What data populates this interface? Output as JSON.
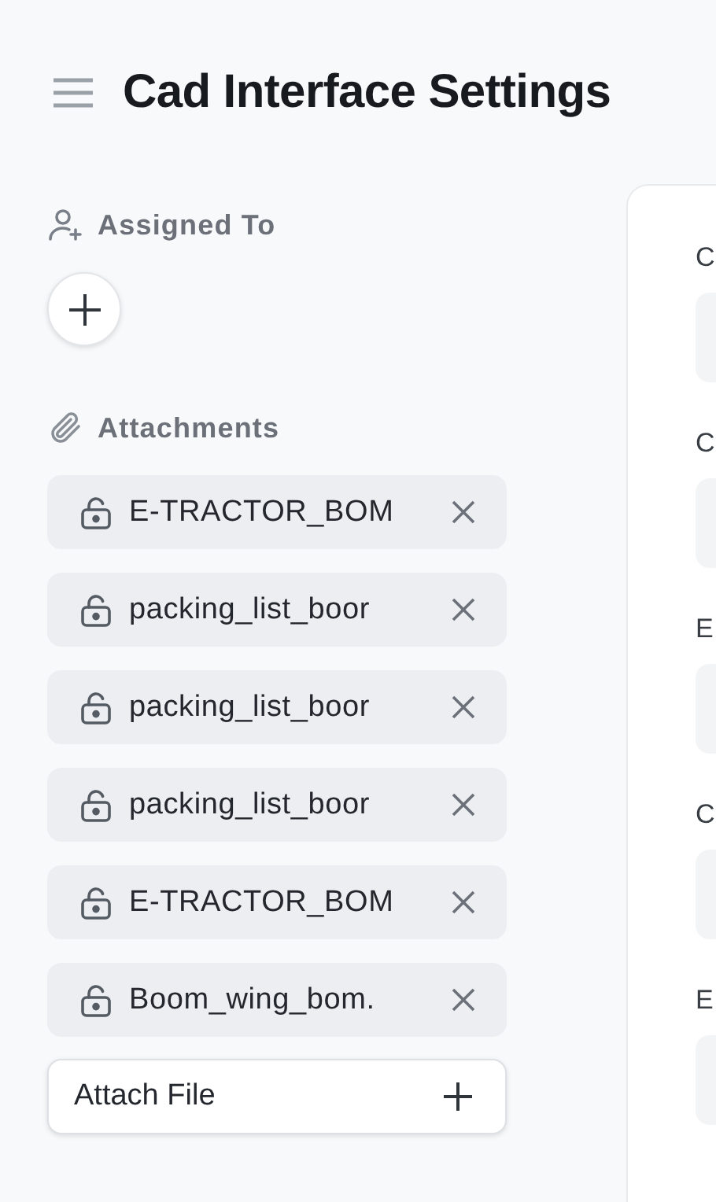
{
  "header": {
    "title": "Cad Interface Settings"
  },
  "sidebar": {
    "assigned_to": {
      "label": "Assigned To"
    },
    "attachments": {
      "label": "Attachments",
      "files": [
        {
          "name": "E-TRACTOR_BOM"
        },
        {
          "name": "packing_list_boor"
        },
        {
          "name": "packing_list_boor"
        },
        {
          "name": "packing_list_boor"
        },
        {
          "name": "E-TRACTOR_BOM"
        },
        {
          "name": "Boom_wing_bom."
        }
      ],
      "attach_button": "Attach File"
    }
  },
  "form": {
    "fields": [
      {
        "label": "C"
      },
      {
        "label": "C"
      },
      {
        "label": "E"
      },
      {
        "label": "C"
      },
      {
        "label": "E"
      }
    ]
  }
}
